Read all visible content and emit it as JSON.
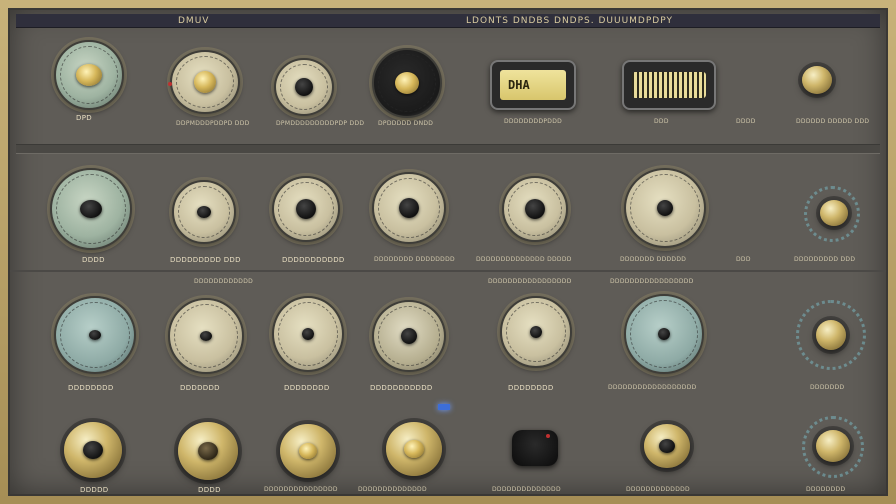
{
  "header": {
    "title_left": "DMUV",
    "title_right": "LDONTS DNDBS DNDPS. DUUUMDPDPY"
  },
  "row1": {
    "knob1_label": "DPD",
    "knob2_label": "DDPMDDDPDDPD DDD",
    "knob3_label": "DPMDDDDDDDDDPDP DDD",
    "knob4_label": "DPDDDDD DNDD",
    "display1_text": "DHA",
    "display1_label": "DDDDDDDDPDDD",
    "display2_label": "DDD",
    "knob7_label": "DDDDDD DDDDD DDD",
    "side_label": "DDDD"
  },
  "row2": {
    "knob1_label": "DDDD",
    "knob2_label": "DDDDDDDDD DDD",
    "knob3_label": "DDDDDDDDDDD",
    "knob4_label": "DDDDDDDD DDDDDDDD",
    "knob5_label": "DDDDDDDDDDDDDD DDDDD",
    "knob6_label": "DDDDDDD DDDDDD",
    "side_label": "DDD",
    "knob7_label": "DDDDDDDDD DDD"
  },
  "row3": {
    "header_left": "DDDDDDDDDDDD",
    "header_mid": "DDDDDDDDDDDDDDDDD",
    "header_right": "DDDDDDDDDDDDDDDDD",
    "knob1_label": "DDDDDDDD",
    "knob2_label": "DDDDDDD",
    "knob3_label": "DDDDDDDD",
    "knob4_label": "DDDDDDDDDDD",
    "knob5_label": "DDDDDDDD",
    "knob6_label": "DDDDDDDDDDDDDDDDDD",
    "knob7_label": "DDDDDDD"
  },
  "row4": {
    "knob1_label": "DDDDD",
    "knob2_label": "DDDD",
    "knob3_label": "DDDDDDDDDDDDDDD",
    "knob4_label": "DDDDDDDDDDDDDD",
    "knob5_label": "DDDDDDDDDDDDDD",
    "knob6_label": "DDDDDDDDDDDDD",
    "knob7_label": "DDDDDDDD"
  }
}
